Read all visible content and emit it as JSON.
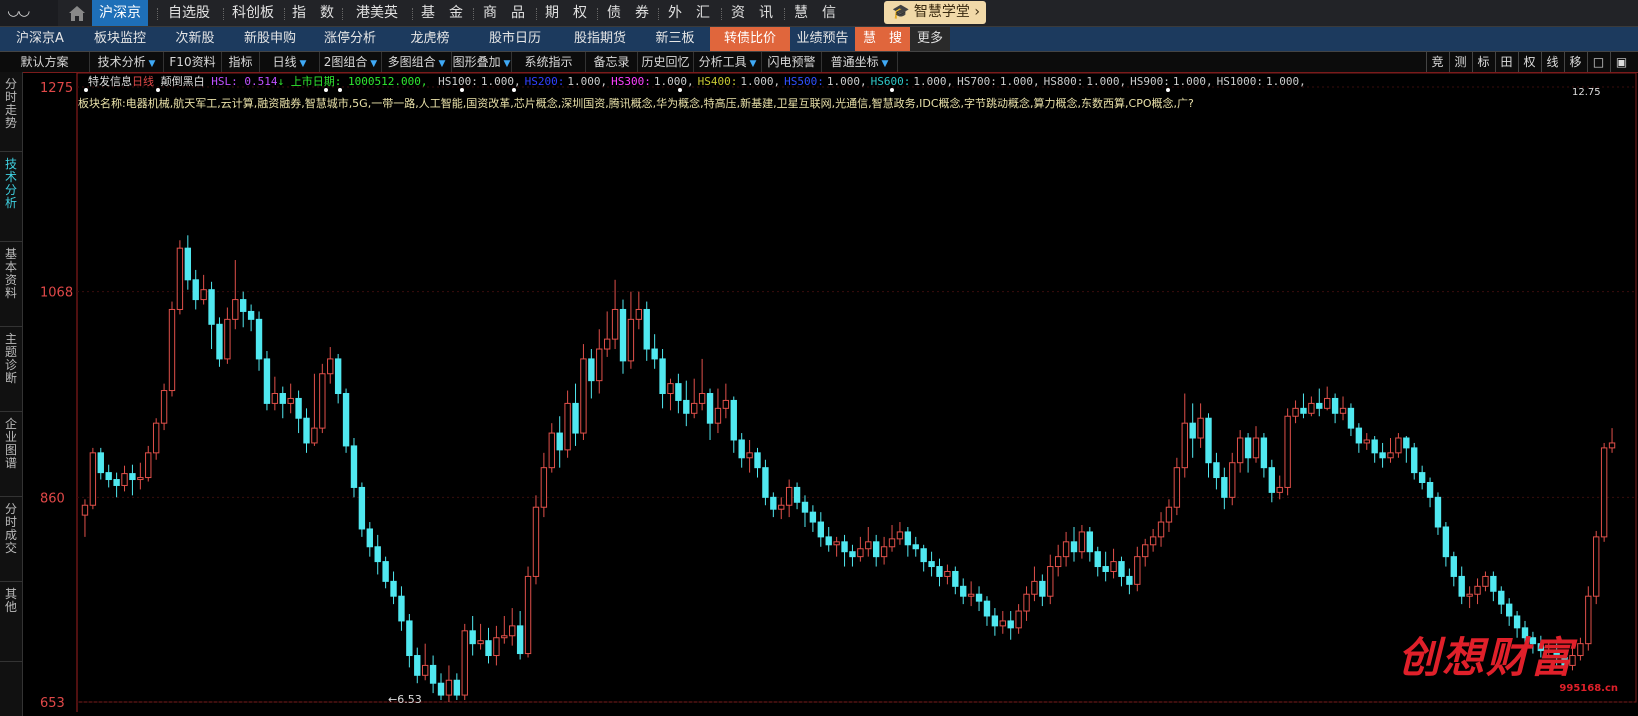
{
  "topnav": {
    "logo": "",
    "items": [
      "沪深京",
      "自选股",
      "科创板",
      "指　数",
      "港美英",
      "基　金",
      "商　品",
      "期　权",
      "债　券",
      "外　汇",
      "资　讯",
      "慧　信"
    ],
    "academy": "智慧学堂"
  },
  "subnav": {
    "items": [
      "沪深京A",
      "板块监控",
      "次新股",
      "新股申购",
      "涨停分析",
      "龙虎榜",
      "股市日历",
      "股指期货",
      "新三板",
      "转债比价",
      "业绩预告",
      "慧　搜",
      "更多"
    ]
  },
  "toolbar": {
    "items": [
      "默认方案",
      "技术分析",
      "F10资料",
      "指标",
      "日线",
      "2图组合",
      "多图组合",
      "图形叠加",
      "系统指示",
      "备忘录",
      "历史回忆",
      "分析工具",
      "闪电预警",
      "普通坐标"
    ],
    "right": [
      "竞",
      "测",
      "标",
      "田",
      "权",
      "线",
      "移",
      "□",
      "▣"
    ]
  },
  "lefttabs": [
    "分时走势",
    "技术分析",
    "基本资料",
    "主题诊断",
    "企业图谱",
    "分时成交",
    "其他"
  ],
  "info": {
    "prefix": "特发信息",
    "period": "日线",
    "mode": "颠倒黑白",
    "hsl_label": "HSL:",
    "hsl_value": "0.514",
    "hsl_arrow": "↓",
    "listed": "上市日期:",
    "listed_value": "1000512.000,",
    "hs_items": [
      {
        "label": "HS100:",
        "value": "1.000,",
        "color": "#cccccc"
      },
      {
        "label": "HS200:",
        "value": "1.000,",
        "color": "#3040ff"
      },
      {
        "label": "HS300:",
        "value": "1.000,",
        "color": "#ff40ff"
      },
      {
        "label": "HS400:",
        "value": "1.000,",
        "color": "#c8c832"
      },
      {
        "label": "HS500:",
        "value": "1.000,",
        "color": "#3050ff"
      },
      {
        "label": "HS600:",
        "value": "1.000,",
        "color": "#30c8c8"
      },
      {
        "label": "HS700:",
        "value": "1.000,",
        "color": "#cccccc"
      },
      {
        "label": "HS800:",
        "value": "1.000,",
        "color": "#cccccc"
      },
      {
        "label": "HS900:",
        "value": "1.000,",
        "color": "#cccccc"
      },
      {
        "label": "HS1000:",
        "value": "1.000,",
        "color": "#cccccc"
      }
    ]
  },
  "sector": "板块名称:电器机械,航天军工,云计算,融资融券,智慧城市,5G,一带一路,人工智能,国资改革,芯片概念,深圳国资,腾讯概念,华为概念,特高压,新基建,卫星互联网,光通信,智慧政务,IDC概念,字节跳动概念,算力概念,东数西算,CPO概念,广?",
  "yaxis": {
    "ticks": [
      "1275",
      "1068",
      "860",
      "653"
    ]
  },
  "low_label": "←6.53",
  "high_label": "12.75",
  "watermark": {
    "text": "创想财富",
    "url": "995168.cn"
  },
  "colors": {
    "up": "#e0504a",
    "down": "#50e8f0",
    "accent": "#1e6fb8"
  },
  "chart_data": {
    "type": "candlestick",
    "ylim": [
      653,
      1275
    ],
    "candles": [
      [
        842,
        852,
        820,
        858
      ],
      [
        852,
        905,
        848,
        910
      ],
      [
        905,
        885,
        878,
        910
      ],
      [
        885,
        878,
        870,
        893
      ],
      [
        878,
        872,
        860,
        885
      ],
      [
        872,
        884,
        866,
        892
      ],
      [
        884,
        878,
        862,
        893
      ],
      [
        878,
        880,
        868,
        895
      ],
      [
        880,
        905,
        876,
        912
      ],
      [
        905,
        935,
        898,
        940
      ],
      [
        935,
        968,
        928,
        975
      ],
      [
        968,
        1050,
        962,
        1058
      ],
      [
        1050,
        1112,
        1045,
        1120
      ],
      [
        1112,
        1080,
        1070,
        1125
      ],
      [
        1080,
        1060,
        1050,
        1090
      ],
      [
        1060,
        1070,
        1055,
        1085
      ],
      [
        1070,
        1035,
        1010,
        1078
      ],
      [
        1035,
        1000,
        992,
        1042
      ],
      [
        1000,
        1040,
        995,
        1052
      ],
      [
        1040,
        1060,
        1030,
        1100
      ],
      [
        1060,
        1048,
        1032,
        1068
      ],
      [
        1048,
        1040,
        1028,
        1055
      ],
      [
        1040,
        1000,
        988,
        1048
      ],
      [
        1000,
        955,
        948,
        1008
      ],
      [
        955,
        965,
        948,
        982
      ],
      [
        965,
        955,
        940,
        972
      ],
      [
        955,
        960,
        945,
        975
      ],
      [
        960,
        940,
        925,
        968
      ],
      [
        940,
        915,
        905,
        950
      ],
      [
        915,
        930,
        912,
        985
      ],
      [
        930,
        985,
        925,
        995
      ],
      [
        985,
        1000,
        975,
        1012
      ],
      [
        1000,
        965,
        955,
        1005
      ],
      [
        965,
        912,
        905,
        970
      ],
      [
        912,
        870,
        860,
        920
      ],
      [
        870,
        828,
        820,
        875
      ],
      [
        828,
        810,
        800,
        835
      ],
      [
        810,
        795,
        782,
        822
      ],
      [
        795,
        775,
        768,
        800
      ],
      [
        775,
        760,
        752,
        785
      ],
      [
        760,
        735,
        725,
        770
      ],
      [
        735,
        700,
        688,
        742
      ],
      [
        700,
        680,
        672,
        708
      ],
      [
        680,
        690,
        675,
        712
      ],
      [
        690,
        672,
        662,
        700
      ],
      [
        672,
        660,
        655,
        682
      ],
      [
        660,
        675,
        653,
        690
      ],
      [
        675,
        660,
        655,
        682
      ],
      [
        660,
        725,
        655,
        732
      ],
      [
        725,
        712,
        700,
        740
      ],
      [
        712,
        715,
        706,
        732
      ],
      [
        715,
        700,
        692,
        728
      ],
      [
        700,
        718,
        690,
        730
      ],
      [
        718,
        720,
        712,
        740
      ],
      [
        720,
        730,
        710,
        748
      ],
      [
        730,
        702,
        696,
        745
      ],
      [
        702,
        780,
        698,
        790
      ],
      [
        780,
        850,
        772,
        862
      ],
      [
        850,
        890,
        840,
        905
      ],
      [
        890,
        925,
        885,
        935
      ],
      [
        925,
        908,
        890,
        942
      ],
      [
        908,
        955,
        900,
        968
      ],
      [
        955,
        925,
        912,
        975
      ],
      [
        925,
        1000,
        918,
        1015
      ],
      [
        1000,
        978,
        960,
        1010
      ],
      [
        978,
        1010,
        965,
        1030
      ],
      [
        1010,
        1020,
        1002,
        1048
      ],
      [
        1020,
        1050,
        1010,
        1080
      ],
      [
        1050,
        998,
        985,
        1060
      ],
      [
        998,
        1040,
        990,
        1068
      ],
      [
        1040,
        1050,
        1030,
        1068
      ],
      [
        1050,
        1010,
        998,
        1058
      ],
      [
        1010,
        1000,
        990,
        1025
      ],
      [
        1000,
        965,
        950,
        1010
      ],
      [
        965,
        975,
        948,
        980
      ],
      [
        975,
        958,
        945,
        985
      ],
      [
        958,
        945,
        932,
        978
      ],
      [
        945,
        955,
        940,
        980
      ],
      [
        955,
        965,
        948,
        1000
      ],
      [
        965,
        935,
        918,
        970
      ],
      [
        935,
        950,
        925,
        970
      ],
      [
        950,
        958,
        940,
        975
      ],
      [
        958,
        918,
        905,
        962
      ],
      [
        918,
        900,
        890,
        925
      ],
      [
        900,
        905,
        885,
        918
      ],
      [
        905,
        890,
        880,
        910
      ],
      [
        890,
        860,
        852,
        898
      ],
      [
        860,
        848,
        840,
        865
      ],
      [
        848,
        852,
        838,
        860
      ],
      [
        852,
        870,
        840,
        878
      ],
      [
        870,
        855,
        848,
        875
      ],
      [
        855,
        845,
        830,
        862
      ],
      [
        845,
        835,
        825,
        852
      ],
      [
        835,
        820,
        810,
        845
      ],
      [
        820,
        812,
        805,
        830
      ],
      [
        812,
        815,
        800,
        820
      ],
      [
        815,
        805,
        790,
        822
      ],
      [
        805,
        800,
        790,
        812
      ],
      [
        800,
        808,
        795,
        820
      ],
      [
        808,
        815,
        800,
        830
      ],
      [
        815,
        800,
        790,
        822
      ],
      [
        800,
        810,
        792,
        820
      ],
      [
        810,
        818,
        805,
        832
      ],
      [
        818,
        825,
        812,
        835
      ],
      [
        825,
        812,
        800,
        830
      ],
      [
        812,
        808,
        800,
        820
      ],
      [
        808,
        795,
        785,
        812
      ],
      [
        795,
        790,
        780,
        805
      ],
      [
        790,
        780,
        770,
        798
      ],
      [
        780,
        785,
        772,
        792
      ],
      [
        785,
        770,
        762,
        790
      ],
      [
        770,
        760,
        752,
        778
      ],
      [
        760,
        762,
        750,
        775
      ],
      [
        762,
        755,
        745,
        770
      ],
      [
        755,
        740,
        730,
        760
      ],
      [
        740,
        730,
        720,
        748
      ],
      [
        730,
        735,
        722,
        745
      ],
      [
        735,
        728,
        716,
        745
      ],
      [
        728,
        745,
        722,
        752
      ],
      [
        745,
        762,
        735,
        770
      ],
      [
        762,
        775,
        755,
        790
      ],
      [
        775,
        760,
        750,
        782
      ],
      [
        760,
        790,
        752,
        802
      ],
      [
        790,
        800,
        780,
        812
      ],
      [
        800,
        815,
        790,
        825
      ],
      [
        815,
        805,
        795,
        830
      ],
      [
        805,
        825,
        798,
        832
      ],
      [
        825,
        805,
        795,
        830
      ],
      [
        805,
        790,
        780,
        810
      ],
      [
        790,
        785,
        775,
        805
      ],
      [
        785,
        795,
        778,
        808
      ],
      [
        795,
        780,
        770,
        800
      ],
      [
        780,
        772,
        762,
        788
      ],
      [
        772,
        800,
        765,
        810
      ],
      [
        800,
        812,
        790,
        818
      ],
      [
        812,
        820,
        805,
        828
      ],
      [
        820,
        835,
        810,
        845
      ],
      [
        835,
        850,
        825,
        858
      ],
      [
        850,
        890,
        842,
        900
      ],
      [
        890,
        935,
        880,
        965
      ],
      [
        935,
        920,
        900,
        955
      ],
      [
        920,
        940,
        910,
        955
      ],
      [
        940,
        895,
        880,
        945
      ],
      [
        895,
        880,
        868,
        905
      ],
      [
        880,
        860,
        848,
        890
      ],
      [
        860,
        895,
        852,
        905
      ],
      [
        895,
        920,
        885,
        928
      ],
      [
        920,
        900,
        885,
        925
      ],
      [
        900,
        920,
        895,
        932
      ],
      [
        920,
        890,
        880,
        925
      ],
      [
        890,
        865,
        855,
        898
      ],
      [
        865,
        870,
        858,
        882
      ],
      [
        870,
        942,
        862,
        950
      ],
      [
        942,
        950,
        935,
        958
      ],
      [
        950,
        945,
        940,
        965
      ],
      [
        945,
        955,
        942,
        962
      ],
      [
        955,
        950,
        942,
        970
      ],
      [
        950,
        960,
        948,
        972
      ],
      [
        960,
        945,
        935,
        965
      ],
      [
        945,
        950,
        938,
        962
      ],
      [
        950,
        930,
        922,
        955
      ],
      [
        930,
        915,
        905,
        935
      ],
      [
        915,
        918,
        908,
        925
      ],
      [
        918,
        905,
        895,
        922
      ],
      [
        905,
        900,
        890,
        915
      ],
      [
        900,
        905,
        895,
        920
      ],
      [
        905,
        920,
        900,
        925
      ],
      [
        920,
        910,
        895,
        922
      ],
      [
        910,
        885,
        878,
        915
      ],
      [
        885,
        875,
        868,
        892
      ],
      [
        875,
        860,
        850,
        880
      ],
      [
        860,
        830,
        822,
        865
      ],
      [
        830,
        800,
        790,
        835
      ],
      [
        800,
        780,
        770,
        805
      ],
      [
        780,
        760,
        752,
        790
      ],
      [
        760,
        762,
        748,
        770
      ],
      [
        762,
        770,
        752,
        778
      ],
      [
        770,
        780,
        765,
        785
      ],
      [
        780,
        765,
        755,
        785
      ],
      [
        765,
        752,
        742,
        770
      ],
      [
        752,
        740,
        730,
        758
      ],
      [
        740,
        728,
        718,
        745
      ],
      [
        728,
        718,
        712,
        735
      ],
      [
        718,
        712,
        702,
        724
      ],
      [
        712,
        705,
        698,
        720
      ],
      [
        705,
        705,
        700,
        715
      ],
      [
        705,
        698,
        690,
        712
      ],
      [
        698,
        690,
        682,
        706
      ],
      [
        690,
        700,
        685,
        710
      ],
      [
        700,
        712,
        695,
        718
      ],
      [
        712,
        760,
        705,
        770
      ],
      [
        760,
        820,
        752,
        826
      ],
      [
        820,
        910,
        815,
        915
      ],
      [
        910,
        915,
        905,
        930
      ]
    ]
  }
}
